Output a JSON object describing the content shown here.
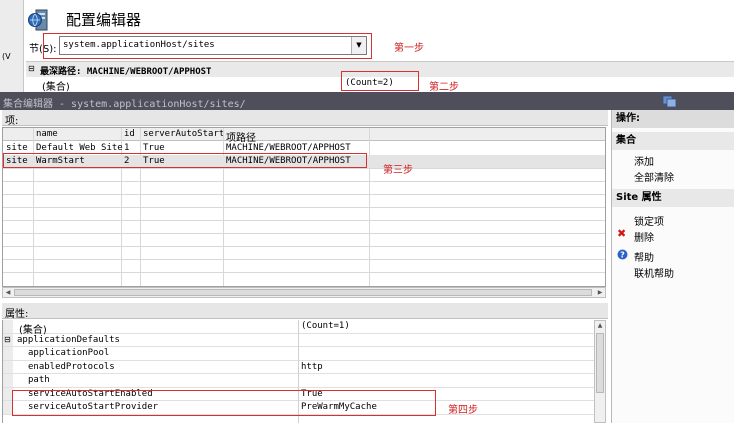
{
  "header": {
    "title": "配置编辑器",
    "section_label": "节(S):",
    "section_value": "system.applicationHost/sites",
    "deepest_path_label": "最深路径: MACHINE/WEBROOT/APPHOST",
    "collection_label": "(集合)",
    "collection_value": "(Count=2)"
  },
  "left_strip_text": "(V",
  "editor": {
    "title": "集合编辑器 - system.applicationHost/sites/"
  },
  "items": {
    "header": "项:",
    "columns": [
      "name",
      "id",
      "serverAutoStart",
      "项路径"
    ],
    "rows": [
      {
        "type": "site",
        "name": "Default Web Site",
        "id": "1",
        "serverAutoStart": "True",
        "path": "MACHINE/WEBROOT/APPHOST"
      },
      {
        "type": "site",
        "name": "WarmStart",
        "id": "2",
        "serverAutoStart": "True",
        "path": "MACHINE/WEBROOT/APPHOST"
      }
    ]
  },
  "properties": {
    "header": "属性:",
    "rows": [
      {
        "name": "(集合)",
        "value": "(Count=1)"
      },
      {
        "name": "applicationDefaults",
        "value": ""
      },
      {
        "name": "applicationPool",
        "value": ""
      },
      {
        "name": "enabledProtocols",
        "value": "http"
      },
      {
        "name": "path",
        "value": ""
      },
      {
        "name": "serviceAutoStartEnabled",
        "value": "True"
      },
      {
        "name": "serviceAutoStartProvider",
        "value": "PreWarmMyCache"
      }
    ]
  },
  "actions": {
    "header": "操作:",
    "collection_header": "集合",
    "add": "添加",
    "clear_all": "全部清除",
    "site_props_header": "Site 属性",
    "lock": "锁定项",
    "delete": "删除",
    "help": "帮助",
    "online_help": "联机帮助"
  },
  "annotations": {
    "step1": "第一步",
    "step2": "第二步",
    "step3": "第三步",
    "step4": "第四步"
  },
  "colors": {
    "annotation_red": "#d83030",
    "editor_bar": "#4f4f5c",
    "selected_row": "#e4e4e4",
    "delete_icon": "#d01818",
    "help_icon": "#2a62c8"
  }
}
